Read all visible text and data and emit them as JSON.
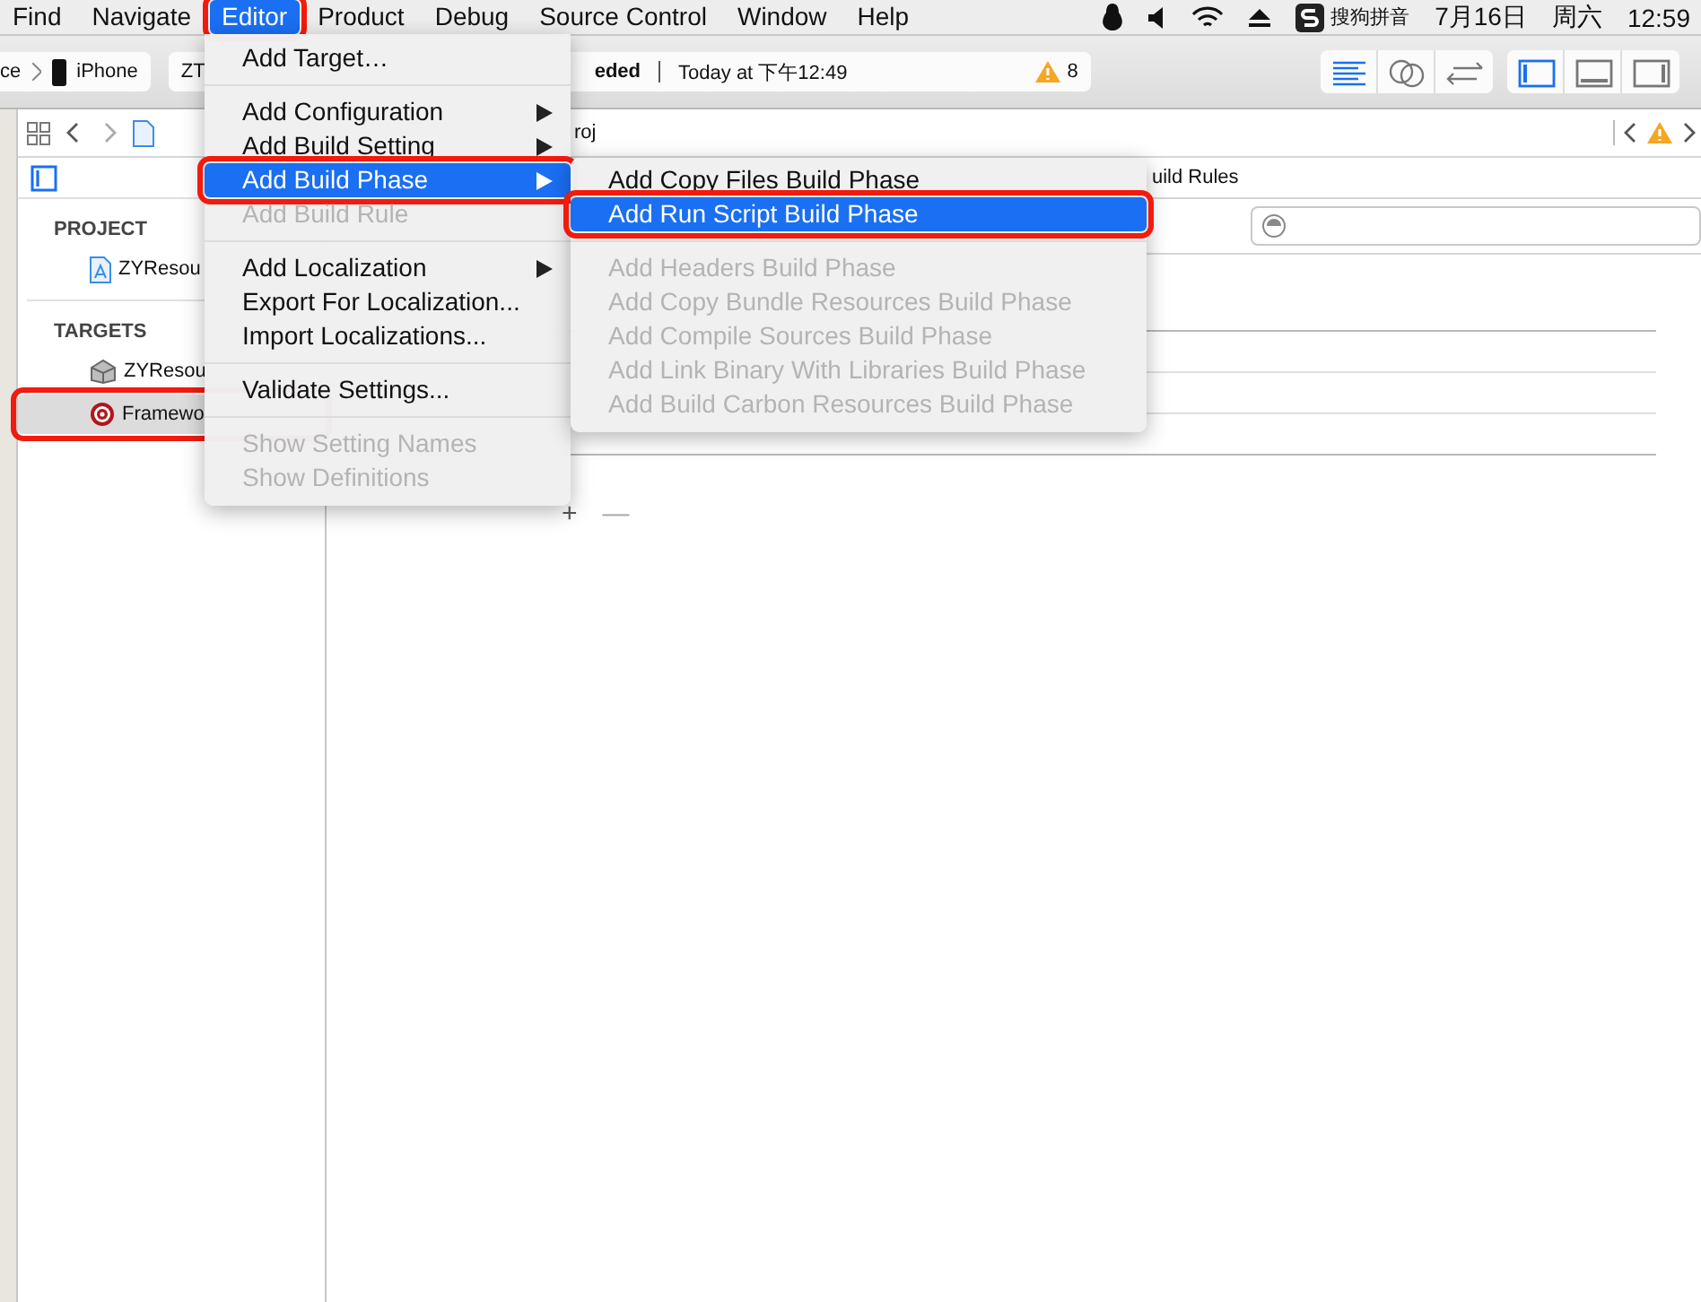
{
  "menu_bar": {
    "items": [
      {
        "label": "Find",
        "selected": false,
        "annotated": false
      },
      {
        "label": "Navigate",
        "selected": false,
        "annotated": false
      },
      {
        "label": "Editor",
        "selected": true,
        "annotated": true
      },
      {
        "label": "Product",
        "selected": false,
        "annotated": false
      },
      {
        "label": "Debug",
        "selected": false,
        "annotated": false
      },
      {
        "label": "Source Control",
        "selected": false,
        "annotated": false
      },
      {
        "label": "Window",
        "selected": false,
        "annotated": false
      },
      {
        "label": "Help",
        "selected": false,
        "annotated": false
      }
    ],
    "status": {
      "input_method": "搜狗拼音",
      "date": "7月16日",
      "weekday": "周六",
      "time": "12:59"
    }
  },
  "toolbar": {
    "scheme": {
      "device_cut": "ce",
      "device": "iPhone"
    },
    "target_cut": "ZT",
    "activity": {
      "status_cut": "eded",
      "time": "Today at 下午12:49",
      "warnings": "8"
    },
    "editor_modes": [
      {
        "kind": "standard",
        "selected": true
      },
      {
        "kind": "assistant",
        "selected": false
      },
      {
        "kind": "version",
        "selected": false
      }
    ],
    "views": [
      {
        "kind": "navigator",
        "selected": true
      },
      {
        "kind": "debug",
        "selected": false
      },
      {
        "kind": "utilities",
        "selected": false
      }
    ]
  },
  "jump_bar": {
    "path_cut": "roj"
  },
  "sidebar": {
    "sections": [
      {
        "title": "PROJECT",
        "items": [
          {
            "label": "ZYResou",
            "kind": "project",
            "selected": false,
            "annotated": false
          }
        ]
      },
      {
        "title": "TARGETS",
        "items": [
          {
            "label": "ZYResou",
            "kind": "bundle",
            "selected": false,
            "annotated": false
          },
          {
            "label": "Framewo",
            "kind": "aggregate",
            "selected": true,
            "annotated": true
          }
        ]
      }
    ]
  },
  "editor": {
    "tab_cut": "uild Rules",
    "add_label": "+",
    "remove_label": "—"
  },
  "editor_menu": {
    "items": [
      {
        "kind": "item",
        "label": "Add Target…",
        "disabled": false,
        "submenu": false,
        "selected": false,
        "annotated": false
      },
      {
        "kind": "separator"
      },
      {
        "kind": "item",
        "label": "Add Configuration",
        "disabled": false,
        "submenu": true,
        "selected": false,
        "annotated": false
      },
      {
        "kind": "item",
        "label": "Add Build Setting",
        "disabled": false,
        "submenu": true,
        "selected": false,
        "annotated": false
      },
      {
        "kind": "item",
        "label": "Add Build Phase",
        "disabled": false,
        "submenu": true,
        "selected": true,
        "annotated": true
      },
      {
        "kind": "item",
        "label": "Add Build Rule",
        "disabled": true,
        "submenu": false,
        "selected": false,
        "annotated": false
      },
      {
        "kind": "separator"
      },
      {
        "kind": "item",
        "label": "Add Localization",
        "disabled": false,
        "submenu": true,
        "selected": false,
        "annotated": false
      },
      {
        "kind": "item",
        "label": "Export For Localization...",
        "disabled": false,
        "submenu": false,
        "selected": false,
        "annotated": false
      },
      {
        "kind": "item",
        "label": "Import Localizations...",
        "disabled": false,
        "submenu": false,
        "selected": false,
        "annotated": false
      },
      {
        "kind": "separator"
      },
      {
        "kind": "item",
        "label": "Validate Settings...",
        "disabled": false,
        "submenu": false,
        "selected": false,
        "annotated": false
      },
      {
        "kind": "separator"
      },
      {
        "kind": "item",
        "label": "Show Setting Names",
        "disabled": true,
        "submenu": false,
        "selected": false,
        "annotated": false
      },
      {
        "kind": "item",
        "label": "Show Definitions",
        "disabled": true,
        "submenu": false,
        "selected": false,
        "annotated": false
      }
    ]
  },
  "build_phase_submenu": {
    "items": [
      {
        "kind": "item",
        "label": "Add Copy Files Build Phase",
        "disabled": false,
        "submenu": false,
        "selected": false,
        "annotated": false
      },
      {
        "kind": "item",
        "label": "Add Run Script Build Phase",
        "disabled": false,
        "submenu": false,
        "selected": true,
        "annotated": true
      },
      {
        "kind": "separator"
      },
      {
        "kind": "item",
        "label": "Add Headers Build Phase",
        "disabled": true,
        "submenu": false,
        "selected": false,
        "annotated": false
      },
      {
        "kind": "item",
        "label": "Add Copy Bundle Resources Build Phase",
        "disabled": true,
        "submenu": false,
        "selected": false,
        "annotated": false
      },
      {
        "kind": "item",
        "label": "Add Compile Sources Build Phase",
        "disabled": true,
        "submenu": false,
        "selected": false,
        "annotated": false
      },
      {
        "kind": "item",
        "label": "Add Link Binary With Libraries Build Phase",
        "disabled": true,
        "submenu": false,
        "selected": false,
        "annotated": false
      },
      {
        "kind": "item",
        "label": "Add Build Carbon Resources Build Phase",
        "disabled": true,
        "submenu": false,
        "selected": false,
        "annotated": false
      }
    ]
  }
}
